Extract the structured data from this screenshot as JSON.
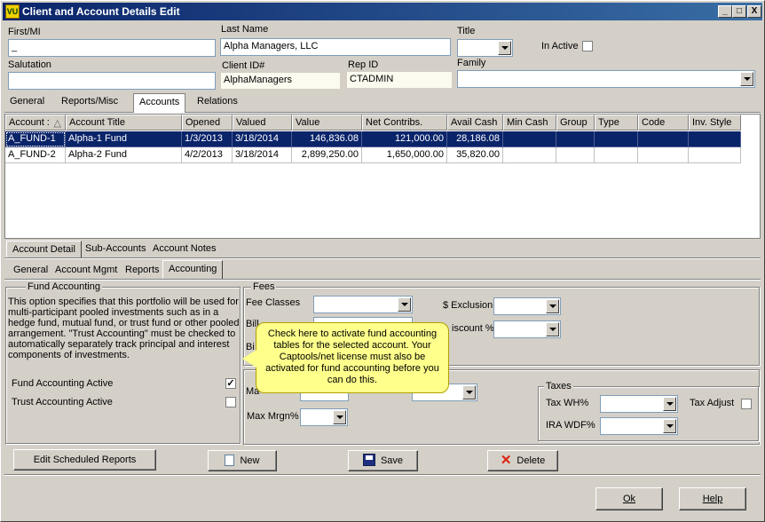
{
  "window": {
    "title": "Client and Account Details Edit",
    "icon_text": "VU",
    "minimize": "_",
    "maximize": "□",
    "close": "X"
  },
  "client": {
    "first_mi_label": "First/MI",
    "first_mi_value": "_",
    "last_name_label": "Last Name",
    "last_name_value": "Alpha Managers, LLC",
    "title_label": "Title",
    "title_value": "",
    "in_active_label": "In Active",
    "salutation_label": "Salutation",
    "salutation_value": "",
    "client_id_label": "Client ID#",
    "client_id_value": "AlphaManagers",
    "rep_id_label": "Rep ID",
    "rep_id_value": "CTADMIN",
    "family_label": "Family",
    "family_value": ""
  },
  "top_tabs": [
    "General",
    "Reports/Misc",
    "Accounts",
    "Relations"
  ],
  "accounts_table": {
    "columns": [
      "Account :",
      "Account Title",
      "Opened",
      "Valued",
      "Value",
      "Net Contribs.",
      "Avail Cash",
      "Min Cash",
      "Group",
      "Type",
      "Code",
      "Inv. Style"
    ],
    "sort_indicator": "△",
    "rows": [
      [
        "A_FUND-1",
        "Alpha-1 Fund",
        "1/3/2013",
        "3/18/2014",
        "146,836.08",
        "121,000.00",
        "28,186.08",
        "",
        "",
        "",
        "",
        ""
      ],
      [
        "A_FUND-2",
        "Alpha-2 Fund",
        "4/2/2013",
        "3/18/2014",
        "2,899,250.00",
        "1,650,000.00",
        "35,820.00",
        "",
        "",
        "",
        "",
        ""
      ]
    ]
  },
  "account_tabs": [
    "Account Detail",
    "Sub-Accounts",
    "Account Notes"
  ],
  "detail_tabs": [
    "General",
    "Account Mgmt",
    "Reports",
    "Accounting"
  ],
  "fund_accounting": {
    "legend": "Fund Accounting",
    "description": "This option specifies that this portfolio will be used for multi-participant pooled investments such as in a hedge fund, mutual fund, or trust fund or other pooled arrangement.  \"Trust Accounting\" must be checked to automatically separately track principal and interest components of investments.",
    "fund_active_label": "Fund Accounting Active",
    "fund_active_checked": "✓",
    "trust_active_label": "Trust Accounting Active"
  },
  "fees": {
    "legend": "Fees",
    "fee_classes_label": "Fee Classes",
    "exclusion_label": "$ Exclusion",
    "bill_label": "Bill",
    "bi_label": "Bi",
    "discount_label": "iscount %"
  },
  "margin": {
    "ma_label": "Ma",
    "max_mrgn_label": "Max Mrgn%"
  },
  "taxes": {
    "legend": "Taxes",
    "tax_wh_label": "Tax WH%",
    "ira_wdf_label": "IRA WDF%",
    "tax_adjust_label": "Tax Adjust"
  },
  "tooltip": {
    "text": "Check here to activate fund accounting tables for the selected account.  Your Captools/net license must also be activated for fund accounting before you can do this."
  },
  "buttons": {
    "edit_scheduled": "Edit Scheduled Reports",
    "new": "New",
    "save": "Save",
    "delete": "Delete",
    "ok": "Ok",
    "help": "Help"
  },
  "colors": {
    "title_bar": "#0a246a",
    "selected_row": "#0a246a",
    "tooltip_bg": "#ffff8c",
    "delete_icon": "#e02010",
    "save_icon": "#203080"
  }
}
